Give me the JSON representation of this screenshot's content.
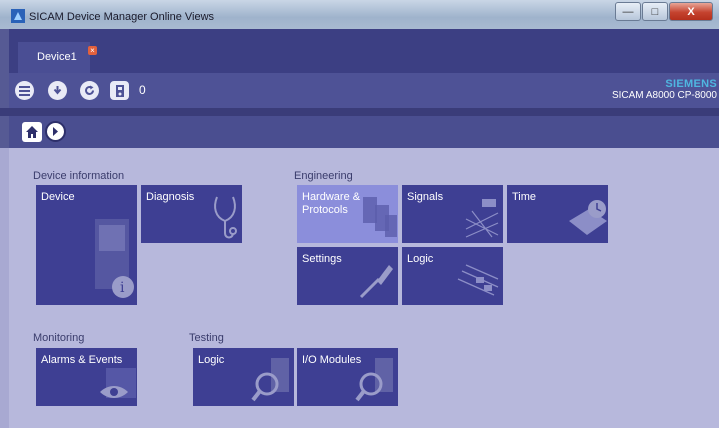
{
  "window": {
    "title": "SICAM Device Manager Online Views",
    "minimize": "—",
    "maximize": "□",
    "close": "X"
  },
  "tabs": [
    {
      "label": "Device1",
      "close": "×"
    }
  ],
  "toolbar": {
    "count": "0",
    "brand": "SIEMENS",
    "model": "SICAM A8000 CP-8000"
  },
  "sections": {
    "device_information": {
      "title": "Device information",
      "tiles": [
        {
          "label": "Device",
          "icon": "device-info-icon"
        },
        {
          "label": "Diagnosis",
          "icon": "stethoscope-icon"
        }
      ]
    },
    "engineering": {
      "title": "Engineering",
      "tiles": [
        {
          "label": "Hardware &\nProtocols",
          "icon": "hardware-icon"
        },
        {
          "label": "Signals",
          "icon": "signals-icon"
        },
        {
          "label": "Time",
          "icon": "time-icon"
        },
        {
          "label": "Settings",
          "icon": "screwdriver-icon"
        },
        {
          "label": "Logic",
          "icon": "logic-icon"
        }
      ]
    },
    "monitoring": {
      "title": "Monitoring",
      "tiles": [
        {
          "label": "Alarms & Events",
          "icon": "alarm-eye-icon"
        }
      ]
    },
    "testing": {
      "title": "Testing",
      "tiles": [
        {
          "label": "Logic",
          "icon": "test-logic-icon"
        },
        {
          "label": "I/O Modules",
          "icon": "io-test-icon"
        }
      ]
    }
  },
  "colors": {
    "tile": "#3e3f93",
    "tile_active": "#8b8edb",
    "background": "#b7b8dc",
    "brand": "#4fb6e0"
  }
}
